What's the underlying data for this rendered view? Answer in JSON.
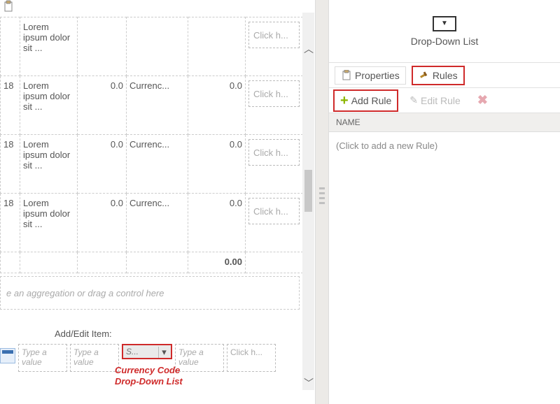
{
  "toolbar": {
    "paste_label": "Paste"
  },
  "grid": {
    "rows": [
      {
        "c0": "",
        "c1": "Lorem ipsum dolor sit ...",
        "c2": "",
        "c3": "",
        "c4": "",
        "click": "Click h..."
      },
      {
        "c0": "18",
        "c1": "Lorem ipsum dolor sit ...",
        "c2": "0.0",
        "c3": "Currenc...",
        "c4": "0.0",
        "click": "Click h..."
      },
      {
        "c0": "18",
        "c1": "Lorem ipsum dolor sit ...",
        "c2": "0.0",
        "c3": "Currenc...",
        "c4": "0.0",
        "click": "Click h..."
      },
      {
        "c0": "18",
        "c1": "Lorem ipsum dolor sit ...",
        "c2": "0.0",
        "c3": "Currenc...",
        "c4": "0.0",
        "click": "Click h..."
      }
    ],
    "total": "0.00",
    "aggregation_hint": "e an aggregation or drag a control here"
  },
  "add_edit": {
    "label": "Add/Edit Item:",
    "placeholder": "Type a value",
    "dropdown_text": "S...",
    "click_placeholder": "Click h...",
    "annotation_line1": "Currency Code",
    "annotation_line2": "Drop-Down List"
  },
  "right": {
    "header": "Drop-Down List",
    "tabs": {
      "properties": "Properties",
      "rules": "Rules"
    },
    "toolbar": {
      "add_rule": "Add Rule",
      "edit_rule": "Edit Rule"
    },
    "column_header": "NAME",
    "empty_hint": "(Click to add a new Rule)"
  }
}
